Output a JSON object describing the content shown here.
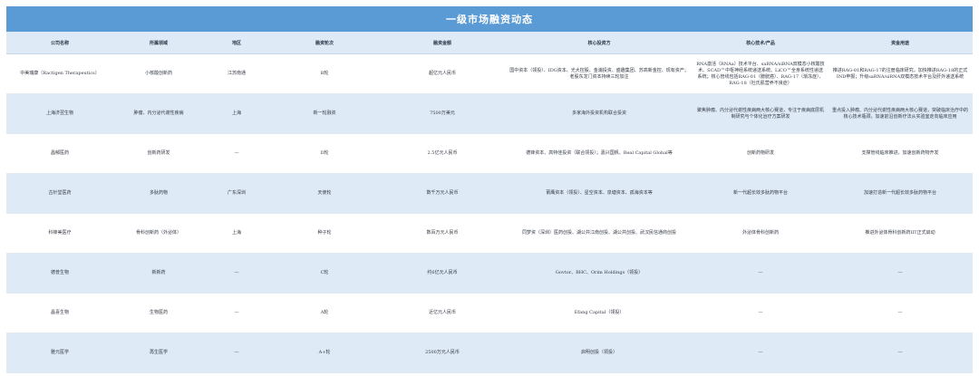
{
  "title": "一级市场融资动态",
  "headers": [
    "公司名称",
    "所属领域",
    "地区",
    "融资轮次",
    "融资金额",
    "核心投资方",
    "核心技术/产品",
    "资金用途"
  ],
  "rows": [
    [
      "中美瑞康（Ractigen Therapeutics）",
      "小核酸创新药",
      "江苏南通",
      "B轮",
      "超亿元人民币",
      "国中资本（领投）、IDG资本、光大控股、金浦投资、盛趣集团、苏高新金控、现有资产；老股东龙门资本持续三轮加注",
      "RNA激活（RNAa）技术平台、saRNA/siRNA双模态小核酸技术、SCAD™中枢神经系统递送系统、LiCO™全身系统性递送系统；核心管线包括RAG-01（膀胱癌）、RAG-17（渐冻症）、RAG-18（杜氏肌营养不良症）",
      "推进RAG-01和RAG-17的注册临床研究，加快推进RAG-18的正式IND申报；升级saRNA/siRNA双模态技术平台及肝外递送系统"
    ],
    [
      "上海济翌生物",
      "肿瘤、内分泌代谢性疾病",
      "上海",
      "新一轮融资",
      "7500万美元",
      "多家海外投资机构联合投资",
      "聚焦肿瘤、内分泌代谢性疾病两大核心赛道，专注于疾病底层机制研究与个体化治疗方案研发",
      "重点投入肿瘤、内分泌代谢性疾病两大核心赛道，突破临床治疗中的核心技术瓶颈，加速前沿创新疗法从实验室走向临床应用"
    ],
    [
      "昌郁医药",
      "创新药研发",
      "—",
      "D轮",
      "2.5亿元人民币",
      "德锋资本、高特佳投资（联合领投）；嘉兴国帆、Real Capital Global等",
      "创新药物研发",
      "支撑管线临床推进，加速创新药物开发"
    ],
    [
      "古针堂医药",
      "多肽药物",
      "广东深圳",
      "天使轮",
      "数千万元人民币",
      "莆鹰资本（领投）、星空资本、泉塘资本、孤海资本等",
      "新一代超长效多肽药物平台",
      "加速打造新一代超长效多肽药物平台"
    ],
    [
      "科锋美医疗",
      "骨科创新药（外泌体）",
      "上海",
      "种子轮",
      "数百万元人民币",
      "同梦资（深圳）医药创投、湖公共江南创投、湖公共创投、武汉民信通商创投",
      "外泌体骨科创新药",
      "推进外泌体骨科创新药IIT正式启动"
    ],
    [
      "德普生物",
      "新新药",
      "—",
      "C轮",
      "约6亿元人民币",
      "Govtor、BHC、Orim Holdings（领投）",
      "—",
      "—"
    ],
    [
      "晶喜生物",
      "生物医药",
      "—",
      "A轮",
      "近亿元人民币",
      "Efang Capital（领投）",
      "—",
      "—"
    ],
    [
      "雅元医学",
      "再生医学",
      "—",
      "A+轮",
      "2500万元人民币",
      "启明创投（领投）",
      "—",
      "—"
    ]
  ]
}
